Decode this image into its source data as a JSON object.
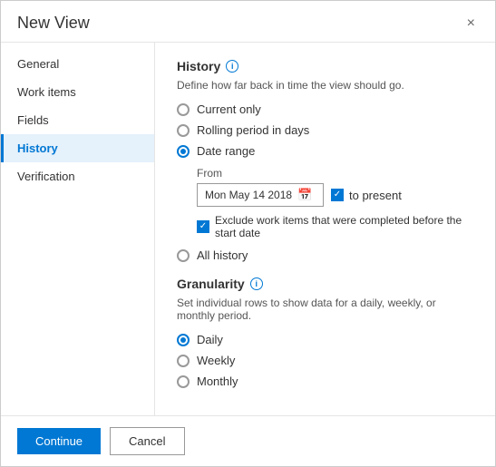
{
  "dialog": {
    "title": "New View",
    "close_label": "×"
  },
  "sidebar": {
    "items": [
      {
        "id": "general",
        "label": "General",
        "active": false
      },
      {
        "id": "work-items",
        "label": "Work items",
        "active": false
      },
      {
        "id": "fields",
        "label": "Fields",
        "active": false
      },
      {
        "id": "history",
        "label": "History",
        "active": true
      },
      {
        "id": "verification",
        "label": "Verification",
        "active": false
      }
    ]
  },
  "content": {
    "section_title": "History",
    "section_desc": "Define how far back in time the view should go.",
    "radio_options": [
      {
        "id": "current-only",
        "label": "Current only",
        "checked": false
      },
      {
        "id": "rolling-period",
        "label": "Rolling period in days",
        "checked": false
      },
      {
        "id": "date-range",
        "label": "Date range",
        "checked": true
      },
      {
        "id": "all-history",
        "label": "All history",
        "checked": false
      }
    ],
    "from_label": "From",
    "date_value": "Mon May 14 2018",
    "to_present_label": "to present",
    "exclude_label": "Exclude work items that were completed before the start date",
    "granularity_title": "Granularity",
    "granularity_desc": "Set individual rows to show data for a daily, weekly, or monthly period.",
    "granularity_options": [
      {
        "id": "daily",
        "label": "Daily",
        "checked": true
      },
      {
        "id": "weekly",
        "label": "Weekly",
        "checked": false
      },
      {
        "id": "monthly",
        "label": "Monthly",
        "checked": false
      }
    ]
  },
  "footer": {
    "continue_label": "Continue",
    "cancel_label": "Cancel"
  }
}
